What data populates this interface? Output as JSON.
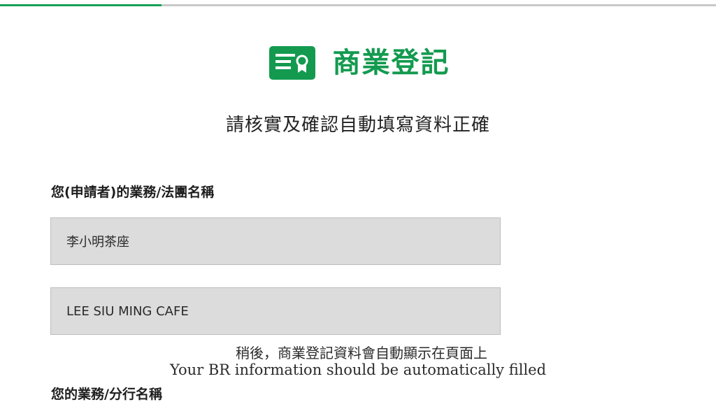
{
  "progress": {
    "fraction": 0.226,
    "track_color": "#c8c8c8",
    "fill_color": "#18a058"
  },
  "brand": {
    "icon": "certificate-icon",
    "title": "商業登記",
    "color": "#139a4f"
  },
  "instruction": "請核實及確認自動填寫資料正確",
  "fields": [
    {
      "label": "您(申請者)的業務/法團名稱",
      "value_zh": "李小明茶座",
      "value_en": "LEE SIU MING CAFE"
    },
    {
      "label": "您的業務/分行名稱"
    }
  ],
  "subtitles": {
    "zh": "稍後，商業登記資料會自動顯示在頁面上",
    "en": "Your BR information should be automatically filled"
  }
}
